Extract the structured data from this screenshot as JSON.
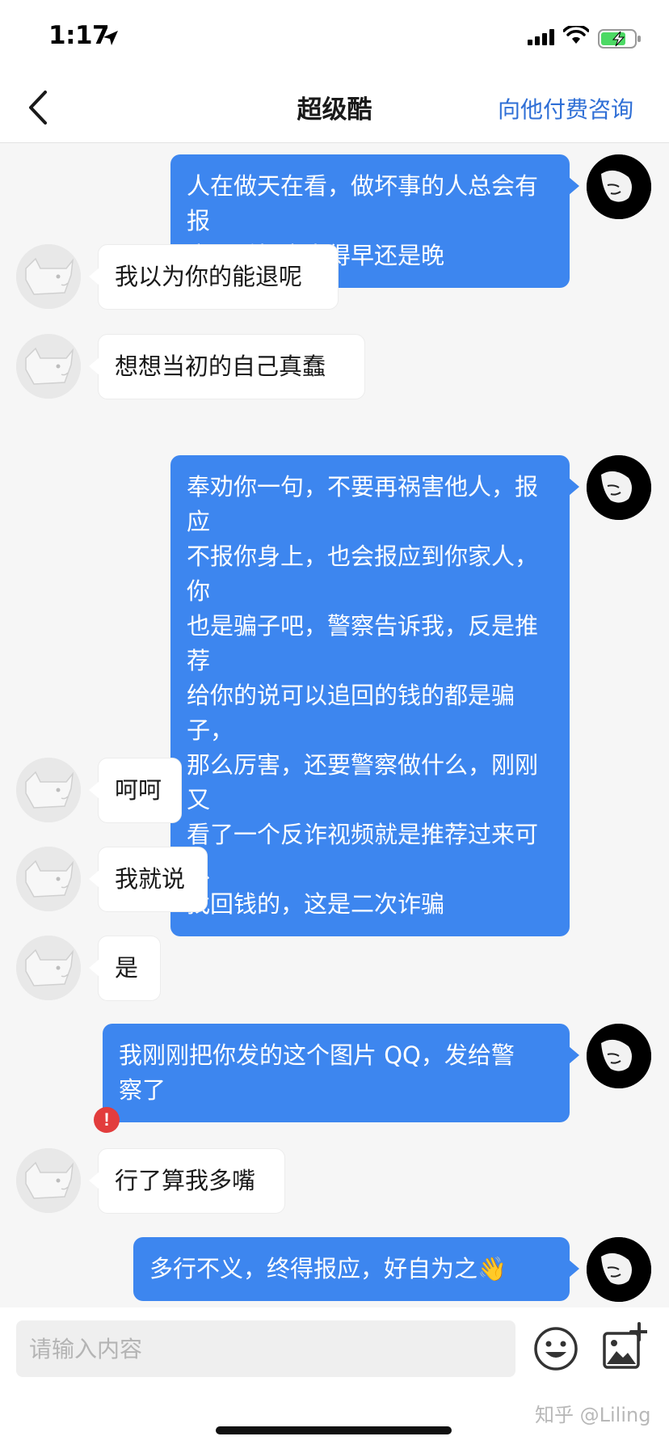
{
  "status_bar": {
    "time": "1:17",
    "battery_color": "#4cd964"
  },
  "nav": {
    "back_icon": "chevron-left-icon",
    "title": "超级酷",
    "action_label": "向他付费咨询"
  },
  "messages": [
    {
      "side": "right",
      "text": "人在做天在看，做坏事的人总会有报\n应，看报应来得早还是晚"
    },
    {
      "side": "left",
      "text": "我以为你的能退呢"
    },
    {
      "side": "left",
      "text": "想想当初的自己真蠢"
    },
    {
      "side": "right",
      "text": "奉劝你一句，不要再祸害他人，报应\n不报你身上，也会报应到你家人，你\n也是骗子吧，警察告诉我，反是推荐\n给你的说可以追回的钱的都是骗子，\n那么厉害，还要警察做什么，刚刚又\n看了一个反诈视频就是推荐过来可以\n找回钱的，这是二次诈骗"
    },
    {
      "side": "left",
      "text": "呵呵"
    },
    {
      "side": "left",
      "text": "我就说"
    },
    {
      "side": "left",
      "text": "是"
    },
    {
      "side": "right",
      "text": "我刚刚把你发的这个图片 QQ，发给警\n察了"
    },
    {
      "side": "left",
      "text": "行了算我多嘴"
    },
    {
      "side": "right",
      "text": "多行不义，终得报应，好自为之",
      "emoji": "👋",
      "failed": true,
      "error_mark": "!"
    }
  ],
  "input": {
    "placeholder": "请输入内容",
    "emoji_icon": "emoji-smile-icon",
    "image_icon": "add-image-icon"
  },
  "watermark": "知乎 @Liling",
  "colors": {
    "accent": "#2f6fd6",
    "bubble_sent": "#3d86ef",
    "error": "#e23d3d"
  }
}
